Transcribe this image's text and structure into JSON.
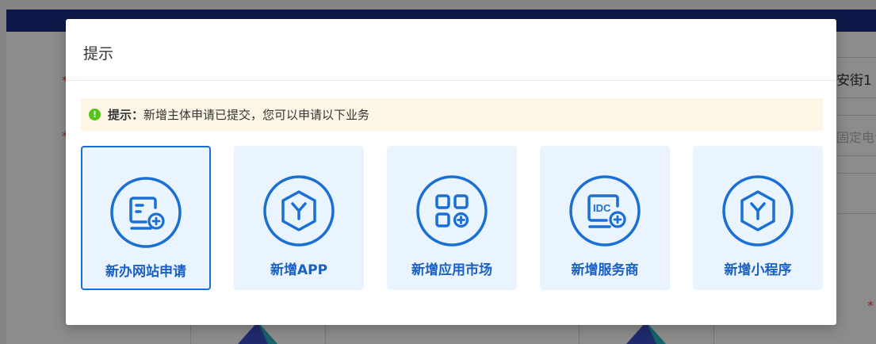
{
  "background": {
    "field_value": "安街1",
    "field_placeholder": "固定电话",
    "required_mark": "*"
  },
  "modal": {
    "title": "提示",
    "notice": {
      "icon": "info-dot-icon",
      "label": "提示：",
      "text": "新增主体申请已提交，您可以申请以下业务"
    },
    "options": [
      {
        "label": "新办网站申请",
        "icon": "website-add-icon",
        "selected": true
      },
      {
        "label": "新增APP",
        "icon": "cube-icon",
        "selected": false
      },
      {
        "label": "新增应用市场",
        "icon": "app-grid-add-icon",
        "selected": false
      },
      {
        "label": "新增服务商",
        "icon": "idc-add-icon",
        "selected": false
      },
      {
        "label": "新增小程序",
        "icon": "cube-icon",
        "selected": false
      }
    ]
  },
  "colors": {
    "accent": "#1a6fd4",
    "card_bg": "#eaf4fe",
    "notice_bg": "#fdf6e6",
    "notice_icon": "#52c41a",
    "topbar": "#1d2c83"
  }
}
